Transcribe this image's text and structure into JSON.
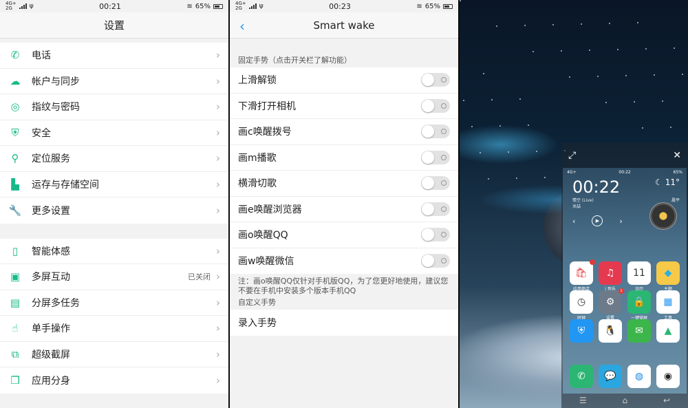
{
  "status_left": {
    "time": "00:21",
    "network_top": "4G+",
    "network_bottom": "2G",
    "battery": "65%"
  },
  "status_mid": {
    "time": "00:23",
    "network_top": "4G+",
    "network_bottom": "2G",
    "battery": "65%"
  },
  "settings": {
    "title": "设置",
    "group1": [
      {
        "label": "电话",
        "icon": "phone-icon",
        "glyph": "✆"
      },
      {
        "label": "帐户与同步",
        "icon": "cloud-icon",
        "glyph": "☁"
      },
      {
        "label": "指纹与密码",
        "icon": "fingerprint-icon",
        "glyph": "◎"
      },
      {
        "label": "安全",
        "icon": "shield-icon",
        "glyph": "⛨"
      },
      {
        "label": "定位服务",
        "icon": "location-icon",
        "glyph": "⚲"
      },
      {
        "label": "运存与存储空间",
        "icon": "sdcard-icon",
        "glyph": "▙"
      },
      {
        "label": "更多设置",
        "icon": "wrench-icon",
        "glyph": "🔧"
      }
    ],
    "group2": [
      {
        "label": "智能体感",
        "icon": "smart-motion-icon",
        "glyph": "▯",
        "sub": ""
      },
      {
        "label": "多屏互动",
        "icon": "multiscreen-icon",
        "glyph": "▣",
        "sub": "已关闭"
      },
      {
        "label": "分屏多任务",
        "icon": "split-screen-icon",
        "glyph": "▤",
        "sub": ""
      },
      {
        "label": "单手操作",
        "icon": "one-hand-icon",
        "glyph": "☝",
        "sub": ""
      },
      {
        "label": "超级截屏",
        "icon": "screenshot-icon",
        "glyph": "⧉",
        "sub": ""
      },
      {
        "label": "应用分身",
        "icon": "app-clone-icon",
        "glyph": "❐",
        "sub": ""
      }
    ]
  },
  "smartwake": {
    "title": "Smart wake",
    "section_fixed": "固定手势（点击开关栏了解功能）",
    "gestures": [
      {
        "label": "上滑解锁",
        "on": false
      },
      {
        "label": "下滑打开相机",
        "on": false
      },
      {
        "label": "画c唤醒拨号",
        "on": false
      },
      {
        "label": "画m播歌",
        "on": false
      },
      {
        "label": "横滑切歌",
        "on": false
      },
      {
        "label": "画e唤醒浏览器",
        "on": false
      },
      {
        "label": "画o唤醒QQ",
        "on": false
      },
      {
        "label": "画w唤醒微信",
        "on": false
      }
    ],
    "note": "注：画o唤醒QQ仅针对手机版QQ，为了您更好地使用，建议您不要在手机中安装多个版本手机QQ",
    "section_custom": "自定义手势",
    "custom_item": "录入手势"
  },
  "recent": {
    "card_time": "00:22",
    "card_battery": "65%",
    "card_network": "4G+",
    "clock": "00:22",
    "temp": "11°",
    "music_title": "情空 (Live)",
    "music_artist": "关喆",
    "weather": "晨平",
    "apps": [
      {
        "name": "应用商店",
        "color": "#ffffff",
        "glyph": "🛍",
        "fg": "#e53935",
        "badge": "7"
      },
      {
        "name": "i 音乐",
        "color": "#e53950",
        "glyph": "♫",
        "fg": "#ffffff",
        "badge": ""
      },
      {
        "name": "日历",
        "color": "#ffffff",
        "glyph": "11",
        "fg": "#333333",
        "badge": ""
      },
      {
        "name": "主题",
        "color": "#f7c948",
        "glyph": "◆",
        "fg": "#2ab0e0",
        "badge": ""
      },
      {
        "name": "时钟",
        "color": "#ffffff",
        "glyph": "◷",
        "fg": "#333333",
        "badge": ""
      },
      {
        "name": "设置",
        "color": "#6c7a89",
        "glyph": "⚙",
        "fg": "#ffffff",
        "badge": "1"
      },
      {
        "name": "一键锁屏",
        "color": "#2bb673",
        "glyph": "🔒",
        "fg": "#ffffff",
        "badge": ""
      },
      {
        "name": "工具",
        "color": "#ffffff",
        "glyph": "▦",
        "fg": "#2196f3",
        "badge": ""
      },
      {
        "name": "",
        "color": "#2196f3",
        "glyph": "⛨",
        "fg": "#ffffff",
        "badge": ""
      },
      {
        "name": "",
        "color": "#ffffff",
        "glyph": "🐧",
        "fg": "#222222",
        "badge": ""
      },
      {
        "name": "",
        "color": "#3cb54a",
        "glyph": "✉",
        "fg": "#ffffff",
        "badge": ""
      },
      {
        "name": "",
        "color": "#ffffff",
        "glyph": "▲",
        "fg": "#2bb673",
        "badge": ""
      }
    ],
    "dock": [
      {
        "color": "#2bb673",
        "glyph": "✆",
        "fg": "#ffffff"
      },
      {
        "color": "#2aa7e0",
        "glyph": "💬",
        "fg": "#ffffff"
      },
      {
        "color": "#ffffff",
        "glyph": "◍",
        "fg": "#1e88e5"
      },
      {
        "color": "#ffffff",
        "glyph": "◉",
        "fg": "#222222"
      }
    ]
  },
  "colors": {
    "accent": "#19b989",
    "link": "#2196f3"
  }
}
